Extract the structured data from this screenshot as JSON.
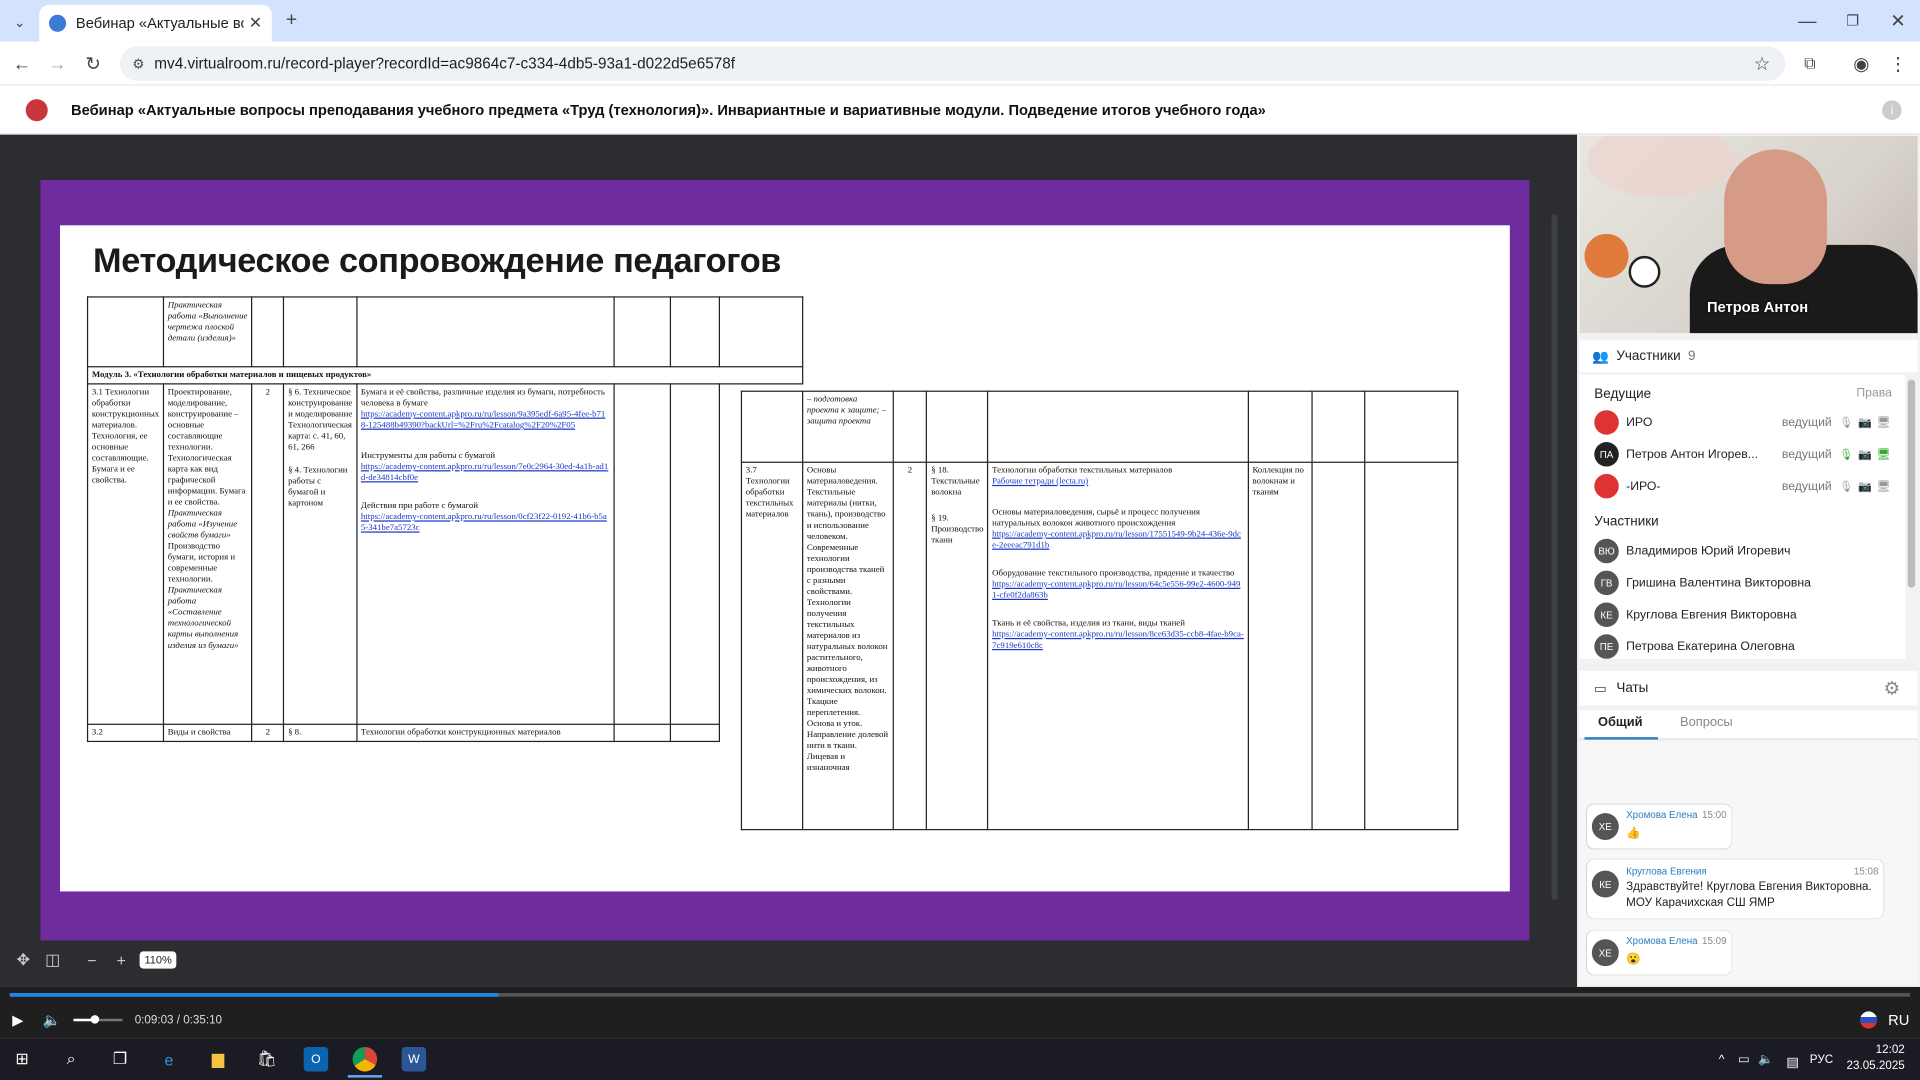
{
  "browser": {
    "tab_title": "Вебинар «Актуальные вопрос",
    "url": "mv4.virtualroom.ru/record-player?recordId=ac9864c7-c334-4db5-93a1-d022d5e6578f"
  },
  "page": {
    "title": "Вебинар «Актуальные вопросы преподавания учебного предмета «Труд (технология)». Инвариантные и вариативные модули. Подведение итогов учебного года»"
  },
  "slide": {
    "title": "Методическое сопровождение педагогов",
    "left_table": {
      "row0_c2": "Практическая работа «Выполнение чертежа плоской детали (изделия)»",
      "module_row": "Модуль 3. «Технологии обработки материалов и пищевых продуктов»",
      "r1_c1": "3.1 Технологии обработки конструкционных материалов. Технология, ее основные составляющие. Бумага и ее свойства.",
      "r1_c2a": "Проектирование, моделирование, конструирование – основные составляющие технологии. Технологическая карта как вид графической информации. Бумага и ее свойства.",
      "r1_c2b": "Практическая работа «Изучение свойств бумаги»",
      "r1_c2c": "Производство бумаги, история и современные технологии.",
      "r1_c2d": "Практическая работа «Составление технологической карты выполнения изделия из бумаги»",
      "r1_c3": "2",
      "r1_c4a": "§ 6. Техническое конструирование и моделирование Технологическая карта: с. 41, 60, 61, 266",
      "r1_c4b": "§ 4. Технологии работы с бумагой и картоном",
      "r1_c5_t1": "Бумага и её свойства, различные изделия из бумаги, потребность человека в бумаге",
      "r1_c5_l1": "https://academy-content.apkpro.ru/ru/lesson/9a395edf-6a95-4fee-b718-125488b49390?backUrl=%2Fru%2Fcatalog%2F20%2F05",
      "r1_c5_t2": "Инструменты для работы с бумагой",
      "r1_c5_l2": "https://academy-content.apkpro.ru/ru/lesson/7e0c2964-30ed-4a1b-ad1d-de34814cbf0e",
      "r1_c5_t3": "Действия при работе с бумагой",
      "r1_c5_l3": "https://academy-content.apkpro.ru/ru/lesson/0cf23f22-0192-41b6-b5a5-341be7a5723c",
      "r2_c1": "3.2",
      "r2_c2": "Виды и свойства",
      "r2_c3": "2",
      "r2_c4": "§ 8.",
      "r2_c5": "Технологии обработки конструкционных материалов"
    },
    "right_table": {
      "top_c2": "– подготовка проекта к защите; – защита проекта",
      "r_c1": "3.7 Технологии обработки текстильных материалов",
      "r_c2": "Основы материаловедения. Текстильные материалы (нитки, ткань), производство и использование человеком. Современные технологии производства тканей с разными свойствами. Технологии получения текстильных материалов из натуральных волокон растительного, животного происхождения, из химических волокон. Ткацкие переплетения. Основа и уток. Направление долевой нити в ткани. Лицевая и изнаночная",
      "r_c3": "2",
      "r_c4a": "§ 18. Текстильные волокна",
      "r_c4b": "§ 19. Производство ткани",
      "r_c5_t1": "Технологии обработки текстильных материалов",
      "r_c5_l1": "Рабочие тетради (lecta.ru)",
      "r_c5_t2": "Основы материаловедения, сырьё и процесс получения натуральных волокон животного происхождения",
      "r_c5_l2": "https://academy-content.apkpro.ru/ru/lesson/17551549-9b24-436e-9dce-2eeeac791d1b",
      "r_c5_t3": "Оборудование текстильного производства, прядение и ткачество",
      "r_c5_l3": "https://academy-content.apkpro.ru/ru/lesson/64c5e556-99e2-4600-9491-cfe0f2da863b",
      "r_c5_t4": "Ткань и её свойства, изделия из ткани, виды тканей",
      "r_c5_l4": "https://academy-content.apkpro.ru/ru/lesson/8ce63d35-ccb8-4fae-b9ca-7c919e610c8c",
      "r_c6": "Коллекция по волокнам и тканям"
    }
  },
  "zoom": {
    "value": "110%"
  },
  "video": {
    "speaker_name": "Петров Антон"
  },
  "participants": {
    "header": "Участники",
    "count": "9",
    "hosts_label": "Ведущие",
    "rights_label": "Права",
    "participants_label": "Участники",
    "hosts": [
      {
        "name": "ИРО",
        "role": "ведущий",
        "initials": ""
      },
      {
        "name": "Петров Антон Игорев...",
        "role": "ведущий",
        "initials": "ПА"
      },
      {
        "name": "-ИРО-",
        "role": "ведущий",
        "initials": ""
      }
    ],
    "members": [
      {
        "name": "Владимиров Юрий Игоревич",
        "initials": "ВЮ"
      },
      {
        "name": "Гришина Валентина Викторовна",
        "initials": "ГВ"
      },
      {
        "name": "Круглова Евгения Викторовна",
        "initials": "КЕ"
      },
      {
        "name": "Петрова Екатерина Олеговна",
        "initials": "ПЕ"
      }
    ]
  },
  "chat": {
    "header": "Чаты",
    "tabs": [
      "Общий",
      "Вопросы"
    ],
    "messages": [
      {
        "initials": "ХЕ",
        "name": "Хромова Елена",
        "time": "15:00",
        "text": "👍"
      },
      {
        "initials": "КЕ",
        "name": "Круглова Евгения",
        "time": "15:08",
        "text": "Здравствуйте! Круглова Евгения Викторовна. МОУ Карачихская СШ ЯМР"
      },
      {
        "initials": "ХЕ",
        "name": "Хромова Елена",
        "time": "15:09",
        "text": "😮"
      }
    ]
  },
  "player": {
    "time": "0:09:03 / 0:35:10",
    "progress": 0.257,
    "lang": "RU"
  },
  "taskbar": {
    "lang": "РУС",
    "time": "12:02",
    "date": "23.05.2025"
  }
}
